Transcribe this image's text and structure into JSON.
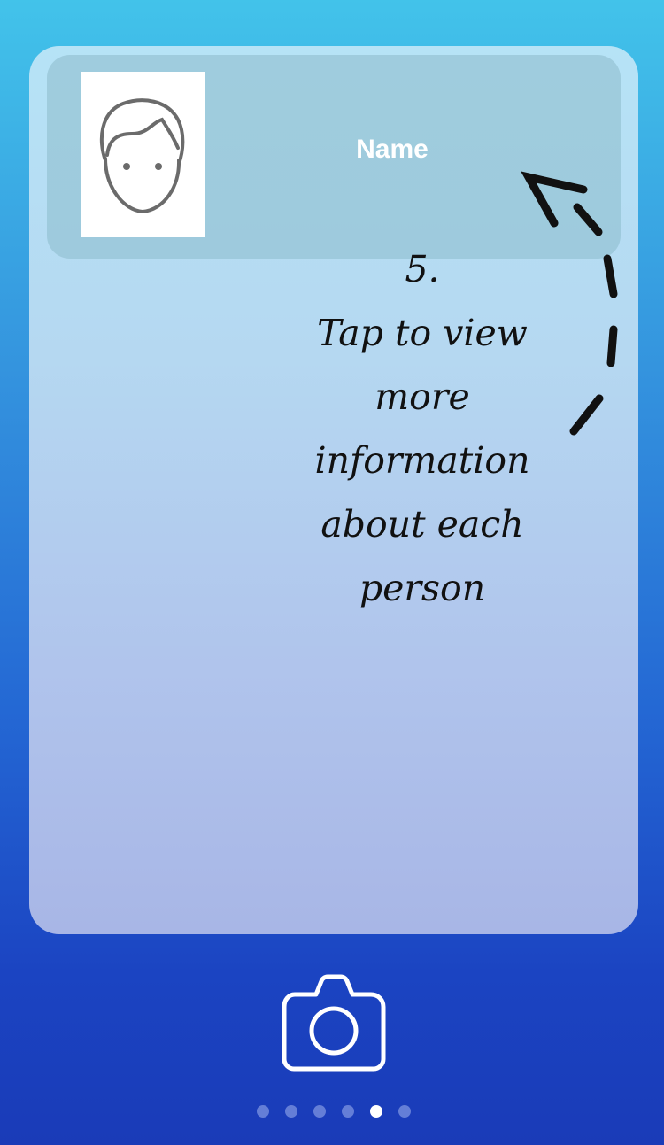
{
  "person": {
    "name": "Name",
    "avatar_icon": "face-outline-icon"
  },
  "hint": {
    "number": "5.",
    "lines": [
      "Tap to view",
      "more",
      "information",
      "about each",
      "person"
    ]
  },
  "camera": {
    "icon": "camera-icon"
  },
  "pager": {
    "total": 6,
    "active_index": 4
  },
  "colors": {
    "background_top": "#42c3ea",
    "background_bottom": "#1a3bb8",
    "card": "#b5d8f1",
    "row": "#96c3d4",
    "text_light": "#ffffff",
    "annotation": "#111111"
  }
}
